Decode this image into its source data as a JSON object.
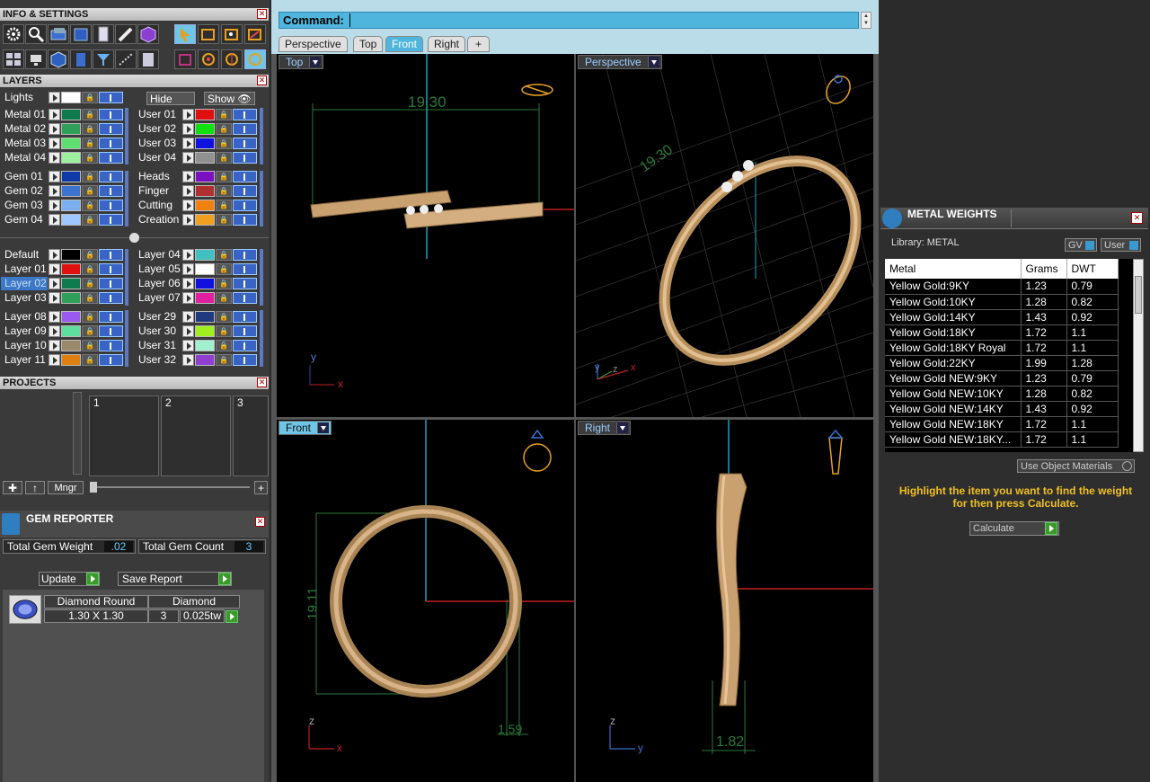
{
  "left": {
    "info_title": "INFO & SETTINGS",
    "layers_title": "LAYERS",
    "lights_label": "Lights",
    "hide_label": "Hide",
    "show_label": "Show",
    "layers_left": [
      {
        "name": "Metal 01",
        "color": "#0f7a4e"
      },
      {
        "name": "Metal 02",
        "color": "#2fa05a"
      },
      {
        "name": "Metal 03",
        "color": "#5fdf6f"
      },
      {
        "name": "Metal 04",
        "color": "#9ef09e"
      },
      {
        "name": "Gem 01",
        "color": "#0e3aa8"
      },
      {
        "name": "Gem 02",
        "color": "#3c74d0"
      },
      {
        "name": "Gem 03",
        "color": "#7ab0f0"
      },
      {
        "name": "Gem 04",
        "color": "#9ec8ff"
      },
      {
        "name": "Default",
        "color": "#000000"
      },
      {
        "name": "Layer 01",
        "color": "#e01010"
      },
      {
        "name": "Layer 02",
        "color": "#0f7a4e"
      },
      {
        "name": "Layer 03",
        "color": "#2fa05a"
      },
      {
        "name": "Layer 08",
        "color": "#9a5af0"
      },
      {
        "name": "Layer 09",
        "color": "#5fdf9f"
      },
      {
        "name": "Layer 10",
        "color": "#9a8a6a"
      },
      {
        "name": "Layer 11",
        "color": "#e08010"
      }
    ],
    "layers_right": [
      {
        "name": "User 01",
        "color": "#e01010"
      },
      {
        "name": "User 02",
        "color": "#10e010"
      },
      {
        "name": "User 03",
        "color": "#1010e0"
      },
      {
        "name": "User 04",
        "color": "#909090"
      },
      {
        "name": "Heads",
        "color": "#7a10c0"
      },
      {
        "name": "Finger",
        "color": "#b03030"
      },
      {
        "name": "Cutting",
        "color": "#f08010"
      },
      {
        "name": "Creation",
        "color": "#f0a020"
      },
      {
        "name": "Layer 04",
        "color": "#40c0c0"
      },
      {
        "name": "Layer 05",
        "color": "#ffffff"
      },
      {
        "name": "Layer 06",
        "color": "#1010e0"
      },
      {
        "name": "Layer 07",
        "color": "#e020a0"
      },
      {
        "name": "User 29",
        "color": "#203a80"
      },
      {
        "name": "User 30",
        "color": "#a0f020"
      },
      {
        "name": "User 31",
        "color": "#a0f0d0"
      },
      {
        "name": "User 32",
        "color": "#9040d0"
      }
    ],
    "projects_title": "PROJECTS",
    "projects": [
      "1",
      "2",
      "3"
    ],
    "mngr_label": "Mngr",
    "gem_reporter_title": "GEM REPORTER",
    "total_gem_weight_label": "Total Gem Weight",
    "total_gem_weight": ".02",
    "total_gem_count_label": "Total Gem Count",
    "total_gem_count": "3",
    "update_label": "Update",
    "save_report_label": "Save Report",
    "gem": {
      "shape": "Diamond Round",
      "material": "Diamond",
      "size": "1.30 X 1.30",
      "count": "3",
      "weight": "0.025tw"
    }
  },
  "center": {
    "command_label": "Command:",
    "tabs": [
      "Perspective",
      "Top",
      "Front",
      "Right",
      "+"
    ],
    "viewports": {
      "top": "Top",
      "perspective": "Perspective",
      "front": "Front",
      "right": "Right"
    },
    "dims": {
      "top_width": "19.30",
      "persp_width": "19.30",
      "front_height": "19.11",
      "front_thickness": "1.59",
      "right_width": "1.82"
    },
    "axes": {
      "x": "x",
      "y": "y",
      "z": "z"
    }
  },
  "right": {
    "title": "METAL WEIGHTS",
    "library_label": "Library: METAL",
    "gv_label": "GV",
    "user_label": "User",
    "columns": [
      "Metal",
      "Grams",
      "DWT"
    ],
    "rows": [
      [
        "Yellow Gold:9KY",
        "1.23",
        "0.79"
      ],
      [
        "Yellow Gold:10KY",
        "1.28",
        "0.82"
      ],
      [
        "Yellow Gold:14KY",
        "1.43",
        "0.92"
      ],
      [
        "Yellow Gold:18KY",
        "1.72",
        "1.1"
      ],
      [
        "Yellow Gold:18KY Royal",
        "1.72",
        "1.1"
      ],
      [
        "Yellow Gold:22KY",
        "1.99",
        "1.28"
      ],
      [
        "Yellow Gold NEW:9KY",
        "1.23",
        "0.79"
      ],
      [
        "Yellow Gold NEW:10KY",
        "1.28",
        "0.82"
      ],
      [
        "Yellow Gold NEW:14KY",
        "1.43",
        "0.92"
      ],
      [
        "Yellow Gold NEW:18KY",
        "1.72",
        "1.1"
      ],
      [
        "Yellow Gold NEW:18KY...",
        "1.72",
        "1.1"
      ]
    ],
    "use_object_materials": "Use Object Materials",
    "hint": "Highlight the item you want to find the weight for then press Calculate.",
    "calculate_label": "Calculate"
  }
}
